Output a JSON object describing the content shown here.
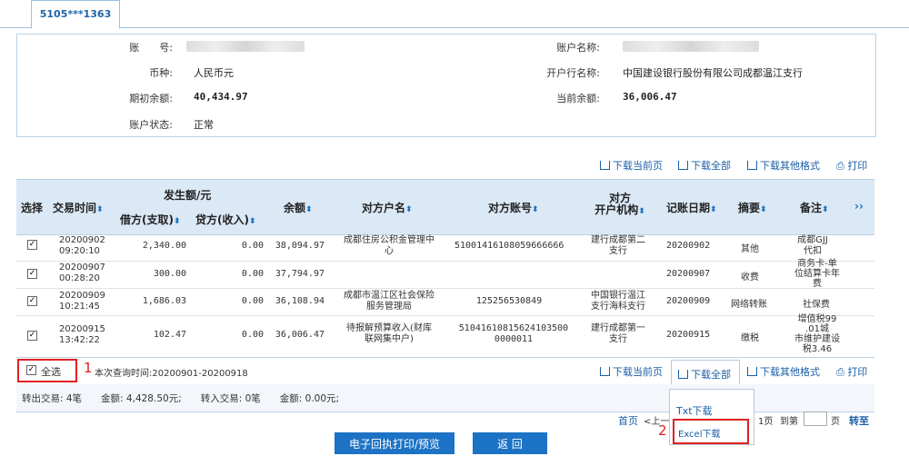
{
  "tab": {
    "label": "5105***1363"
  },
  "account": {
    "number_label": "账　　号:",
    "name_label": "账户名称:",
    "currency_label": "币种:",
    "currency": "人民币元",
    "bank_label": "开户行名称:",
    "bank": "中国建设银行股份有限公司成都温江支行",
    "opening_label": "期初余额:",
    "opening": "40,434.97",
    "current_label": "当前余额:",
    "current": "36,006.47",
    "status_label": "账户状态:",
    "status": "正常"
  },
  "toolbar": {
    "download_page": "下载当前页",
    "download_all": "下载全部",
    "download_other": "下载其他格式",
    "print": "打印"
  },
  "table": {
    "headers": {
      "select": "选择",
      "time": "交易时间",
      "amount_group": "发生额/元",
      "debit": "借方(支取)",
      "credit": "贷方(收入)",
      "balance": "余额",
      "counter_name": "对方户名",
      "counter_account": "对方账号",
      "counter_org_1": "对方",
      "counter_org_2": "开户机构",
      "date": "记账日期",
      "summary": "摘要",
      "remark": "备注",
      "more": "››"
    },
    "rows": [
      {
        "time1": "20200902",
        "time2": "09:20:10",
        "debit": "2,340.00",
        "credit": "0.00",
        "balance": "38,094.97",
        "name1": "成都住房公积金管理中",
        "name2": "心",
        "account": "51001416108059666666",
        "org1": "建行成都第二",
        "org2": "支行",
        "date": "20200902",
        "summary": "其他",
        "remark1": "成都GJJ",
        "remark2": "代扣",
        "remark3": ""
      },
      {
        "time1": "20200907",
        "time2": "00:28:20",
        "debit": "300.00",
        "credit": "0.00",
        "balance": "37,794.97",
        "name1": "",
        "name2": "",
        "account": "",
        "org1": "",
        "org2": "",
        "date": "20200907",
        "summary": "收费",
        "remark1": "商务卡-单",
        "remark2": "位结算卡年",
        "remark3": "费"
      },
      {
        "time1": "20200909",
        "time2": "10:21:45",
        "debit": "1,686.03",
        "credit": "0.00",
        "balance": "36,108.94",
        "name1": "成都市温江区社会保险",
        "name2": "服务管理局",
        "account": "125256530849",
        "org1": "中国银行温江",
        "org2": "支行海科支行",
        "date": "20200909",
        "summary": "网络转账",
        "remark1": "社保费",
        "remark2": "",
        "remark3": ""
      },
      {
        "time1": "20200915",
        "time2": "13:42:22",
        "debit": "102.47",
        "credit": "0.00",
        "balance": "36,006.47",
        "name1": "待报解预算收入(财库",
        "name2": "联网集中户)",
        "account": "51041610815624103500",
        "account2": "0000011",
        "org1": "建行成都第一",
        "org2": "支行",
        "date": "20200915",
        "summary": "缴税",
        "remark1": "增值税99",
        "remark2": ".01城",
        "remark3": "市维护建设",
        "remark4": "税3.46"
      }
    ]
  },
  "footer": {
    "select_all": "全选",
    "marker1": "1",
    "query_time": "本次查询时间:20200901-20200918",
    "summary": "转出交易: 4笔　　金额: 4,428.50元;　　转入交易: 0笔　　金额: 0.00元;"
  },
  "dropdown": {
    "txt": "Txt下载",
    "excel": "Excel下载",
    "marker2": "2"
  },
  "pager": {
    "first": "首页",
    "prev": "<上一",
    "total_suffix": "1页",
    "goto": "到第",
    "page_unit": "页",
    "go": "转至"
  },
  "buttons": {
    "receipt": "电子回执打印/预览",
    "back": "返 回"
  }
}
